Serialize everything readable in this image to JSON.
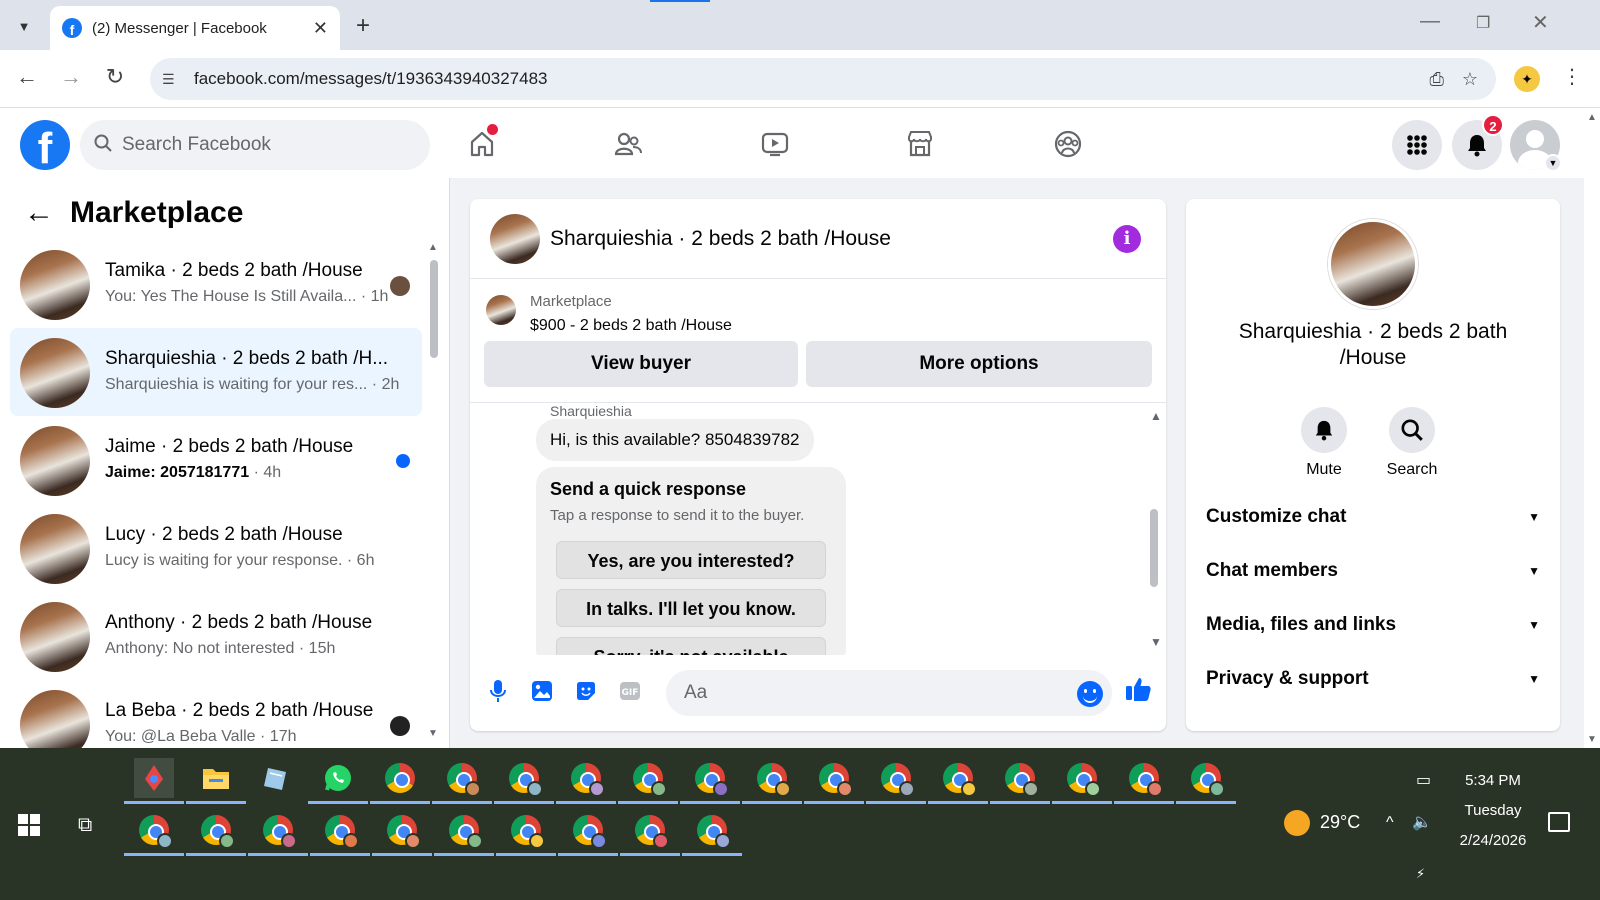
{
  "browser": {
    "tab_title": "(2) Messenger | Facebook",
    "url": "facebook.com/messages/t/1936343940327483"
  },
  "header": {
    "search_placeholder": "Search Facebook",
    "notification_count": "2"
  },
  "sidebar": {
    "title": "Marketplace",
    "chats": [
      {
        "name": "Tamika · 2 beds 2 bath /House",
        "preview": "You: Yes The House Is Still Availa...",
        "time": " · 1h",
        "unread": false
      },
      {
        "name": "Sharquieshia · 2 beds 2 bath /H...",
        "preview": "Sharquieshia is waiting for your res...",
        "time": " · 2h",
        "unread": false
      },
      {
        "name": "Jaime · 2 beds 2 bath /House",
        "preview": "Jaime: 2057181771",
        "time": " · 4h",
        "unread": true
      },
      {
        "name": "Lucy · 2 beds 2 bath /House",
        "preview": "Lucy is waiting for your response.",
        "time": " · 6h",
        "unread": false
      },
      {
        "name": "Anthony · 2 beds 2 bath /House",
        "preview": "Anthony: No not interested",
        "time": " · 15h",
        "unread": false
      },
      {
        "name": "La Beba · 2 beds 2 bath /House",
        "preview": "You: @La Beba Valle",
        "time": " · 17h",
        "unread": false
      }
    ]
  },
  "chat": {
    "name": "Sharquieshia · 2 beds 2 bath /House",
    "listing_label": "Marketplace",
    "listing_price": "$900 - 2 beds 2 bath /House",
    "view_buyer": "View buyer",
    "more_options": "More options",
    "sender": "Sharquieshia",
    "message": "Hi, is this available? 8504839782",
    "quick_title": "Send a quick response",
    "quick_sub": "Tap a response to send it to the buyer.",
    "quick_options": [
      "Yes, are you interested?",
      "In talks. I'll let you know.",
      "Sorry, it's not available"
    ],
    "composer_placeholder": "Aa"
  },
  "info": {
    "name": "Sharquieshia · 2 beds 2 bath /House",
    "mute": "Mute",
    "search": "Search",
    "sections": [
      "Customize chat",
      "Chat members",
      "Media, files and links",
      "Privacy & support"
    ]
  },
  "taskbar": {
    "temperature": "29°C",
    "time": "5:34 PM",
    "day": "Tuesday",
    "date": "2/24/2026"
  },
  "colors": {
    "fb_blue": "#1877f2",
    "messenger_blue": "#0866ff",
    "active_chat_bg": "#ebf5ff",
    "info_purple": "#a32bde",
    "taskbar_bg": "#2a3426"
  }
}
